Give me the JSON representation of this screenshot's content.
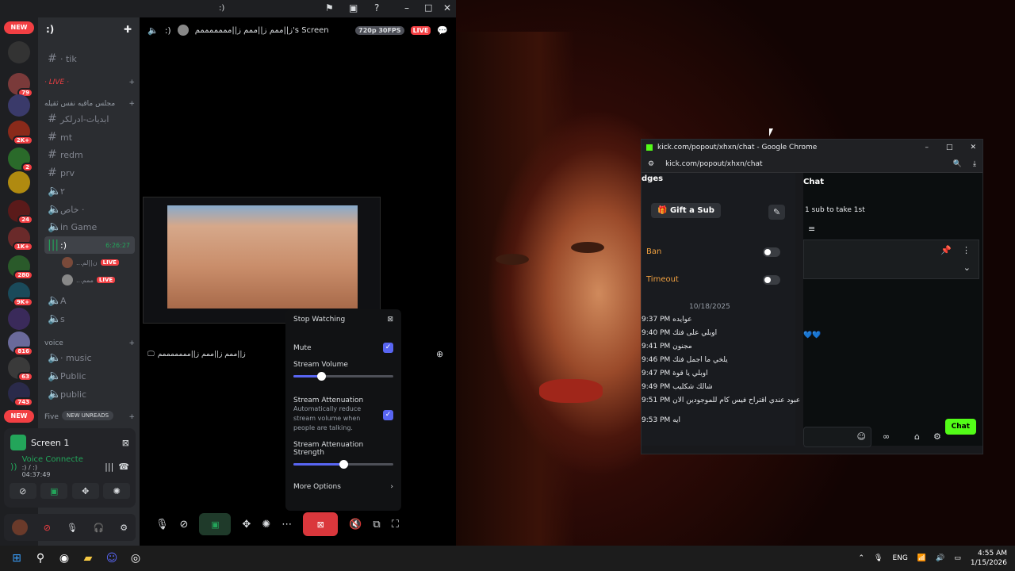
{
  "discord": {
    "title": ":)",
    "guild_name": ":)",
    "stage_title": "ز||ممم ز||ممم ز||مممممممم's Screen",
    "stage_user": ":)",
    "quality_badge": "720p 30FPS",
    "live_badge": "LIVE",
    "new_pill_top": "NEW",
    "new_pill_bottom": "NEW",
    "server_badges": [
      "79",
      "2K+",
      "2",
      "24",
      "1K+",
      "280",
      "9K+",
      "816",
      "63",
      "743"
    ],
    "channels": {
      "tik": "· tik",
      "live_cat": "· LIVE ·",
      "arabic_cat": "مجلس ماقيه نفس ثقيله",
      "ch1": "ابديات-ادرلكر",
      "mt": "mt",
      "redm": "redm",
      "prv": "prv",
      "ch_voice1": "٢",
      "ch_khas": "خاص ·",
      "in_game": "in Game",
      "smile": ":)",
      "smile_time": "6:26:27",
      "stream_user1": "...ن||لم",
      "stream_user2": "...ممم",
      "live_label": "LIVE",
      "A": "A",
      "s": "s",
      "voice_cat": "voice",
      "music": "· music",
      "Public": "Public",
      "public": "public",
      "five_cat": "Five",
      "new_unreads": "NEW UNREADS"
    },
    "stream_name_label": "ز||ممم ز||ممم ز||مممممممم",
    "user_panel": {
      "screen_label": "Screen 1",
      "voice_status": "Voice Connecte",
      "voice_channel": ":) / :)",
      "elapsed": "04:37:49"
    },
    "context_menu": {
      "stop_watching": "Stop Watching",
      "mute": "Mute",
      "stream_volume": "Stream Volume",
      "stream_volume_level": 0.28,
      "stream_attenuation": "Stream Attenuation",
      "attenuation_desc": "Automatically reduce stream volume when people are talking.",
      "attenuation_strength": "Stream Attenuation Strength",
      "attenuation_strength_level": 0.5,
      "more_options": "More Options"
    }
  },
  "chrome": {
    "title": "kick.com/popout/xhxn/chat - Google Chrome",
    "url": "kick.com/popout/xhxn/chat",
    "badges_label": "dges",
    "gift_sub": "Gift a Sub",
    "ban": "Ban",
    "timeout": "Timeout",
    "date": "10/18/2025",
    "chat_header": "Chat",
    "sub_prompt": "1 sub to take 1st",
    "chat_button": "Chat",
    "messages": [
      {
        "time": "9:37 PM",
        "text": "عوايده"
      },
      {
        "time": "9:40 PM",
        "text": "اوبلي على فتك"
      },
      {
        "time": "9:41 PM",
        "text": "مجنون"
      },
      {
        "time": "9:46 PM",
        "text": "يلخي ما اجمل فتك"
      },
      {
        "time": "9:47 PM",
        "text": "اوبلي يا قوة"
      },
      {
        "time": "9:49 PM",
        "text": "شالك شكليب"
      },
      {
        "time": "9:51 PM",
        "text": "عبود عندي اقتراح فيس كام للموجودين الان"
      },
      {
        "time": "9:53 PM",
        "text": "ايه"
      }
    ]
  },
  "taskbar": {
    "lang": "ENG",
    "time": "4:55 AM",
    "date": "1/15/2026"
  }
}
